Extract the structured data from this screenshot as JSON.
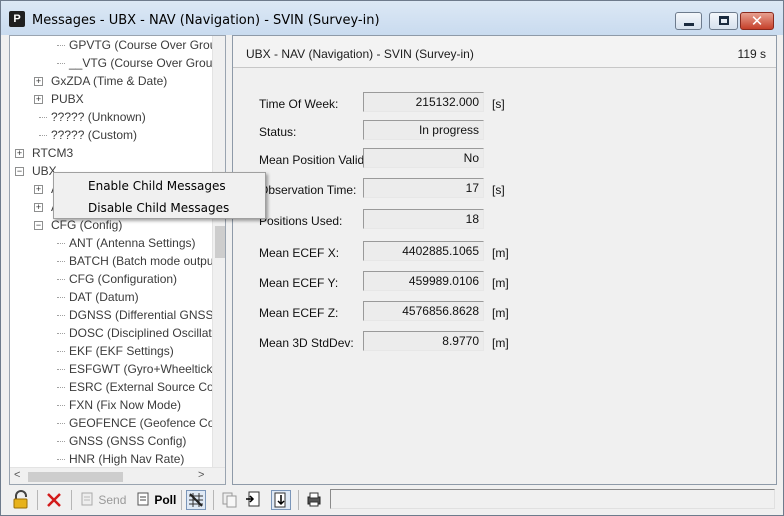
{
  "window": {
    "title": "Messages - UBX - NAV (Navigation) - SVIN (Survey-in)",
    "app_icon_letter": "P"
  },
  "tree": {
    "items": [
      {
        "label": "GPVTG (Course Over Groun",
        "level": 3,
        "expander": ""
      },
      {
        "label": "__VTG (Course Over Groun",
        "level": 3,
        "expander": ""
      },
      {
        "label": "GxZDA (Time & Date)",
        "level": 2,
        "expander": "+"
      },
      {
        "label": "PUBX",
        "level": 2,
        "expander": "+"
      },
      {
        "label": "????? (Unknown)",
        "level": 2,
        "expander": ""
      },
      {
        "label": "????? (Custom)",
        "level": 2,
        "expander": ""
      },
      {
        "label": "RTCM3",
        "level": 1,
        "expander": "+"
      },
      {
        "label": "UBX",
        "level": 1,
        "expander": "-"
      },
      {
        "label": "A",
        "level": 2,
        "expander": "+"
      },
      {
        "label": "A",
        "level": 2,
        "expander": "+"
      },
      {
        "label": "CFG (Config)",
        "level": 2,
        "expander": "-"
      },
      {
        "label": "ANT (Antenna Settings)",
        "level": 3,
        "expander": ""
      },
      {
        "label": "BATCH (Batch mode outpu",
        "level": 3,
        "expander": ""
      },
      {
        "label": "CFG (Configuration)",
        "level": 3,
        "expander": ""
      },
      {
        "label": "DAT (Datum)",
        "level": 3,
        "expander": ""
      },
      {
        "label": "DGNSS (Differential GNSS c",
        "level": 3,
        "expander": ""
      },
      {
        "label": "DOSC (Disciplined Oscillato",
        "level": 3,
        "expander": ""
      },
      {
        "label": "EKF (EKF Settings)",
        "level": 3,
        "expander": ""
      },
      {
        "label": "ESFGWT (Gyro+Wheeltick)",
        "level": 3,
        "expander": ""
      },
      {
        "label": "ESRC (External Source Conf",
        "level": 3,
        "expander": ""
      },
      {
        "label": "FXN (Fix Now Mode)",
        "level": 3,
        "expander": ""
      },
      {
        "label": "GEOFENCE (Geofence Conf",
        "level": 3,
        "expander": ""
      },
      {
        "label": "GNSS (GNSS Config)",
        "level": 3,
        "expander": ""
      },
      {
        "label": "HNR (High Nav Rate)",
        "level": 3,
        "expander": ""
      }
    ],
    "scroll_left": "<",
    "scroll_right": ">"
  },
  "content": {
    "title": "UBX - NAV (Navigation) - SVIN (Survey-in)",
    "elapsed": "119 s",
    "fields": [
      {
        "label": "Time Of Week:",
        "value": "215132.000",
        "unit": "[s]"
      },
      {
        "label": "Status:",
        "value": "In progress",
        "unit": ""
      },
      {
        "label": "Mean Position Valid:",
        "value": "No",
        "unit": ""
      },
      {
        "label": "Observation Time:",
        "value": "17",
        "unit": "[s]"
      },
      {
        "label": "Positions Used:",
        "value": "18",
        "unit": ""
      },
      {
        "label": "Mean ECEF X:",
        "value": "4402885.1065",
        "unit": "[m]"
      },
      {
        "label": "Mean ECEF Y:",
        "value": "459989.0106",
        "unit": "[m]"
      },
      {
        "label": "Mean ECEF Z:",
        "value": "4576856.8628",
        "unit": "[m]"
      },
      {
        "label": "Mean 3D StdDev:",
        "value": "8.9770",
        "unit": "[m]"
      }
    ]
  },
  "context_menu": {
    "items": [
      "Enable Child Messages",
      "Disable Child Messages"
    ]
  },
  "toolbar": {
    "send_label": "Send",
    "poll_label": "Poll",
    "status_text": ""
  }
}
